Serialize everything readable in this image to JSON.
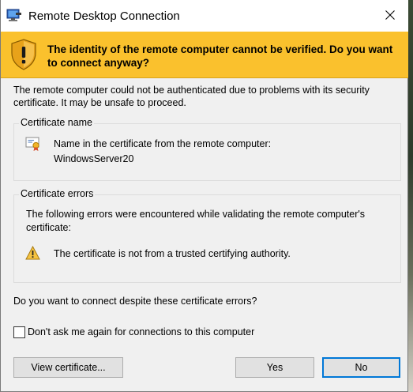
{
  "window": {
    "title": "Remote Desktop Connection",
    "icons": {
      "app": "remote-desktop-icon",
      "close": "close-icon"
    }
  },
  "banner": {
    "message": "The identity of the remote computer cannot be verified. Do you want to connect anyway?",
    "icon": "warning-shield-icon",
    "color": "#fac12d"
  },
  "intro": "The remote computer could not be authenticated due to problems with its security certificate. It may be unsafe to proceed.",
  "certificate_name": {
    "legend": "Certificate name",
    "label": "Name in the certificate from the remote computer:",
    "value": "WindowsServer20",
    "icon": "certificate-icon"
  },
  "certificate_errors": {
    "legend": "Certificate errors",
    "intro": "The following errors were encountered while validating the remote computer's certificate:",
    "items": [
      "The certificate is not from a trusted certifying authority."
    ],
    "icon": "warning-icon"
  },
  "question": "Do you want to connect despite these certificate errors?",
  "dont_ask": {
    "label": "Don't ask me again for connections to this computer",
    "checked": false
  },
  "buttons": {
    "view_certificate": "View certificate...",
    "yes": "Yes",
    "no": "No"
  },
  "colors": {
    "focus_border": "#0078d7",
    "dialog_bg": "#f0f0f0"
  }
}
